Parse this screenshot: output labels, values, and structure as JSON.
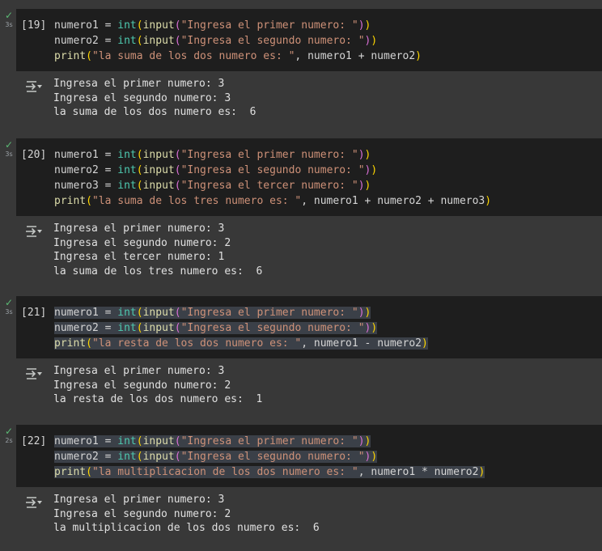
{
  "cells": [
    {
      "exec_count": "[19]",
      "duration": "3s",
      "status_icon": "checkmark-icon",
      "code": [
        [
          [
            "v",
            "numero1"
          ],
          [
            "op",
            " = "
          ],
          [
            "fn",
            "int"
          ],
          [
            "p1",
            "("
          ],
          [
            "bi",
            "input"
          ],
          [
            "p2",
            "("
          ],
          [
            "st",
            "\"Ingresa el primer numero: \""
          ],
          [
            "p2",
            ")"
          ],
          [
            "p1",
            ")"
          ]
        ],
        [
          [
            "v",
            "numero2"
          ],
          [
            "op",
            " = "
          ],
          [
            "fn",
            "int"
          ],
          [
            "p1",
            "("
          ],
          [
            "bi",
            "input"
          ],
          [
            "p2",
            "("
          ],
          [
            "st",
            "\"Ingresa el segundo numero: \""
          ],
          [
            "p2",
            ")"
          ],
          [
            "p1",
            ")"
          ]
        ],
        [
          [
            "kw",
            "print"
          ],
          [
            "p1",
            "("
          ],
          [
            "st",
            "\"la suma de los dos numero es: \""
          ],
          [
            "op",
            ", "
          ],
          [
            "v",
            "numero1"
          ],
          [
            "op",
            " + "
          ],
          [
            "v",
            "numero2"
          ],
          [
            "p1",
            ")"
          ]
        ]
      ],
      "output": [
        "Ingresa el primer numero: 3",
        "Ingresa el segundo numero: 3",
        "la suma de los dos numero es:  6"
      ]
    },
    {
      "exec_count": "[20]",
      "duration": "3s",
      "status_icon": "checkmark-icon",
      "code": [
        [
          [
            "v",
            "numero1"
          ],
          [
            "op",
            " = "
          ],
          [
            "fn",
            "int"
          ],
          [
            "p1",
            "("
          ],
          [
            "bi",
            "input"
          ],
          [
            "p2",
            "("
          ],
          [
            "st",
            "\"Ingresa el primer numero: \""
          ],
          [
            "p2",
            ")"
          ],
          [
            "p1",
            ")"
          ]
        ],
        [
          [
            "v",
            "numero2"
          ],
          [
            "op",
            " = "
          ],
          [
            "fn",
            "int"
          ],
          [
            "p1",
            "("
          ],
          [
            "bi",
            "input"
          ],
          [
            "p2",
            "("
          ],
          [
            "st",
            "\"Ingresa el segundo numero: \""
          ],
          [
            "p2",
            ")"
          ],
          [
            "p1",
            ")"
          ]
        ],
        [
          [
            "v",
            "numero3"
          ],
          [
            "op",
            " = "
          ],
          [
            "fn",
            "int"
          ],
          [
            "p1",
            "("
          ],
          [
            "bi",
            "input"
          ],
          [
            "p2",
            "("
          ],
          [
            "st",
            "\"Ingresa el tercer numero: \""
          ],
          [
            "p2",
            ")"
          ],
          [
            "p1",
            ")"
          ]
        ],
        [
          [
            "kw",
            "print"
          ],
          [
            "p1",
            "("
          ],
          [
            "st",
            "\"la suma de los tres numero es: \""
          ],
          [
            "op",
            ", "
          ],
          [
            "v",
            "numero1"
          ],
          [
            "op",
            " + "
          ],
          [
            "v",
            "numero2"
          ],
          [
            "op",
            " + "
          ],
          [
            "v",
            "numero3"
          ],
          [
            "p1",
            ")"
          ]
        ]
      ],
      "output": [
        "Ingresa el primer numero: 3",
        "Ingresa el segundo numero: 2",
        "Ingresa el tercer numero: 1",
        "la suma de los tres numero es:  6"
      ]
    },
    {
      "exec_count": "[21]",
      "duration": "3s",
      "status_icon": "checkmark-icon",
      "highlighted": true,
      "code": [
        [
          [
            "v",
            "numero1"
          ],
          [
            "op",
            " = "
          ],
          [
            "fn",
            "int"
          ],
          [
            "p1",
            "("
          ],
          [
            "bi",
            "input"
          ],
          [
            "p2",
            "("
          ],
          [
            "st",
            "\"Ingresa el primer numero: \""
          ],
          [
            "p2",
            ")"
          ],
          [
            "p1",
            ")"
          ]
        ],
        [
          [
            "v",
            "numero2"
          ],
          [
            "op",
            " = "
          ],
          [
            "fn",
            "int"
          ],
          [
            "p1",
            "("
          ],
          [
            "bi",
            "input"
          ],
          [
            "p2",
            "("
          ],
          [
            "st",
            "\"Ingresa el segundo numero: \""
          ],
          [
            "p2",
            ")"
          ],
          [
            "p1",
            ")"
          ]
        ],
        [
          [
            "kw",
            "print"
          ],
          [
            "p1",
            "("
          ],
          [
            "st",
            "\"la resta de los dos numero es: \""
          ],
          [
            "op",
            ", "
          ],
          [
            "v",
            "numero1"
          ],
          [
            "op",
            " - "
          ],
          [
            "v",
            "numero2"
          ],
          [
            "p1",
            ")"
          ]
        ]
      ],
      "output": [
        "Ingresa el primer numero: 3",
        "Ingresa el segundo numero: 2",
        "la resta de los dos numero es:  1"
      ]
    },
    {
      "exec_count": "[22]",
      "duration": "2s",
      "status_icon": "checkmark-icon",
      "highlighted": true,
      "code": [
        [
          [
            "v",
            "numero1"
          ],
          [
            "op",
            " = "
          ],
          [
            "fn",
            "int"
          ],
          [
            "p1",
            "("
          ],
          [
            "bi",
            "input"
          ],
          [
            "p2",
            "("
          ],
          [
            "st",
            "\"Ingresa el primer numero: \""
          ],
          [
            "p2",
            ")"
          ],
          [
            "p1",
            ")"
          ]
        ],
        [
          [
            "v",
            "numero2"
          ],
          [
            "op",
            " = "
          ],
          [
            "fn",
            "int"
          ],
          [
            "p1",
            "("
          ],
          [
            "bi",
            "input"
          ],
          [
            "p2",
            "("
          ],
          [
            "st",
            "\"Ingresa el segundo numero: \""
          ],
          [
            "p2",
            ")"
          ],
          [
            "p1",
            ")"
          ]
        ],
        [
          [
            "kw",
            "print"
          ],
          [
            "p1",
            "("
          ],
          [
            "st",
            "\"la multiplicacion de los dos numero es: \""
          ],
          [
            "op",
            ", "
          ],
          [
            "v",
            "numero1"
          ],
          [
            "op",
            " * "
          ],
          [
            "v",
            "numero2"
          ],
          [
            "p1",
            ")"
          ]
        ]
      ],
      "output": [
        "Ingresa el primer numero: 3",
        "Ingresa el segundo numero: 2",
        "la multiplicacion de los dos numero es:  6"
      ]
    }
  ],
  "colors": {
    "page_bg": "#383838",
    "code_bg": "#1e1e1e",
    "check": "#5bb974",
    "string": "#ce9178",
    "builtin": "#dcdcaa",
    "type_fn": "#4ec9b0",
    "paren_outer": "#ffd700",
    "paren_inner": "#da70d6"
  }
}
